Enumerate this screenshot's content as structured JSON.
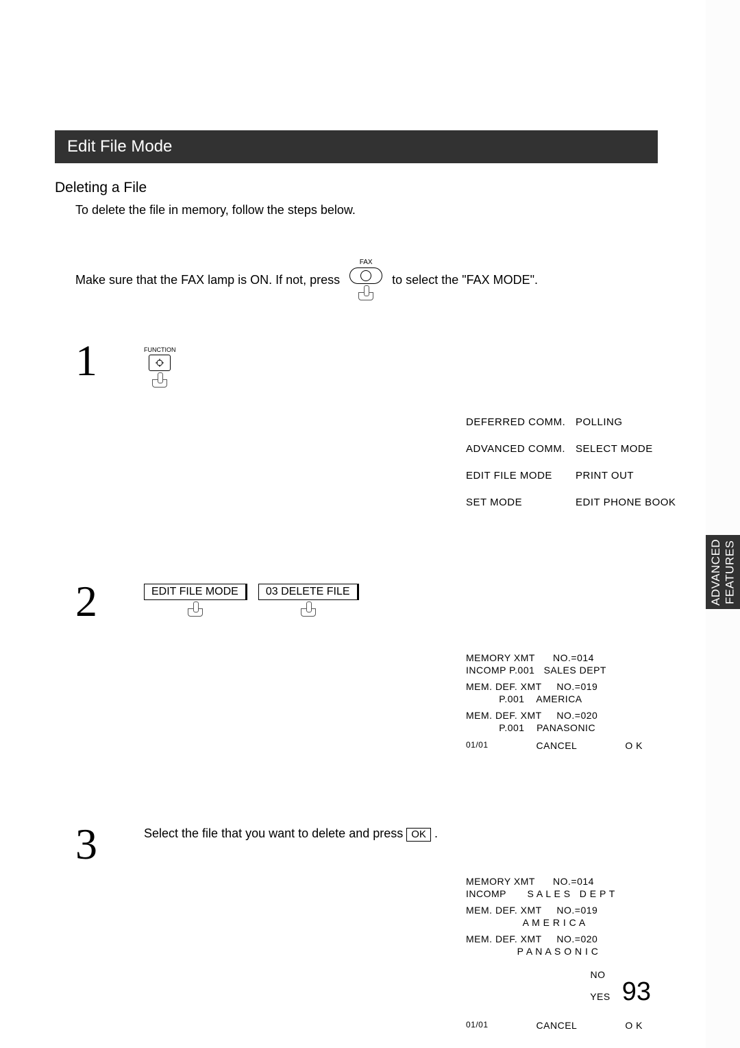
{
  "sidebar_label": "ADVANCED\nFEATURES",
  "title": "Edit File  Mode",
  "section": "Deleting a File",
  "intro": "To delete the file in memory, follow the steps below.",
  "instr_a": "Make sure that the FAX lamp is ON.  If not, press",
  "instr_b": "to select the \"FAX MODE\".",
  "fax_label": "FAX",
  "func_label": "FUNCTION",
  "menu": {
    "r1c1": "DEFERRED COMM.",
    "r1c2": "POLLING",
    "r2c1": "ADVANCED COMM.",
    "r2c2": "SELECT MODE",
    "r3c1": "EDIT FILE MODE",
    "r3c2": "PRINT OUT",
    "r4c1": "SET MODE",
    "r4c2": "EDIT PHONE BOOK"
  },
  "step2_btn1": "EDIT FILE MODE",
  "step2_btn2": "03 DELETE FILE",
  "list1": {
    "l1": "MEMORY XMT      NO.=014",
    "l2": "INCOMP P.001   SALES DEPT",
    "l3": "MEM. DEF. XMT     NO.=019",
    "l4": "           P.001    AMERICA",
    "l5": "MEM. DEF. XMT     NO.=020",
    "l6": "           P.001    PANASONIC",
    "page": "01/01",
    "cancel": "CANCEL",
    "ok": "O K"
  },
  "step3_a": "Select the file that you want to delete and press ",
  "step3_ok": "OK",
  "step3_b": " .",
  "list2": {
    "l1": "MEMORY XMT      NO.=014",
    "l2": "INCOMP       S A L E S   D E P T",
    "l3": "MEM. DEF. XMT     NO.=019",
    "l4": "                   A M E R I C A",
    "l5": "MEM. DEF. XMT     NO.=020",
    "l6": "                 P A N A S O N I C",
    "no": "NO",
    "yes": "YES",
    "page": "01/01",
    "cancel": "CANCEL",
    "ok": "O K"
  },
  "page_number": "93"
}
